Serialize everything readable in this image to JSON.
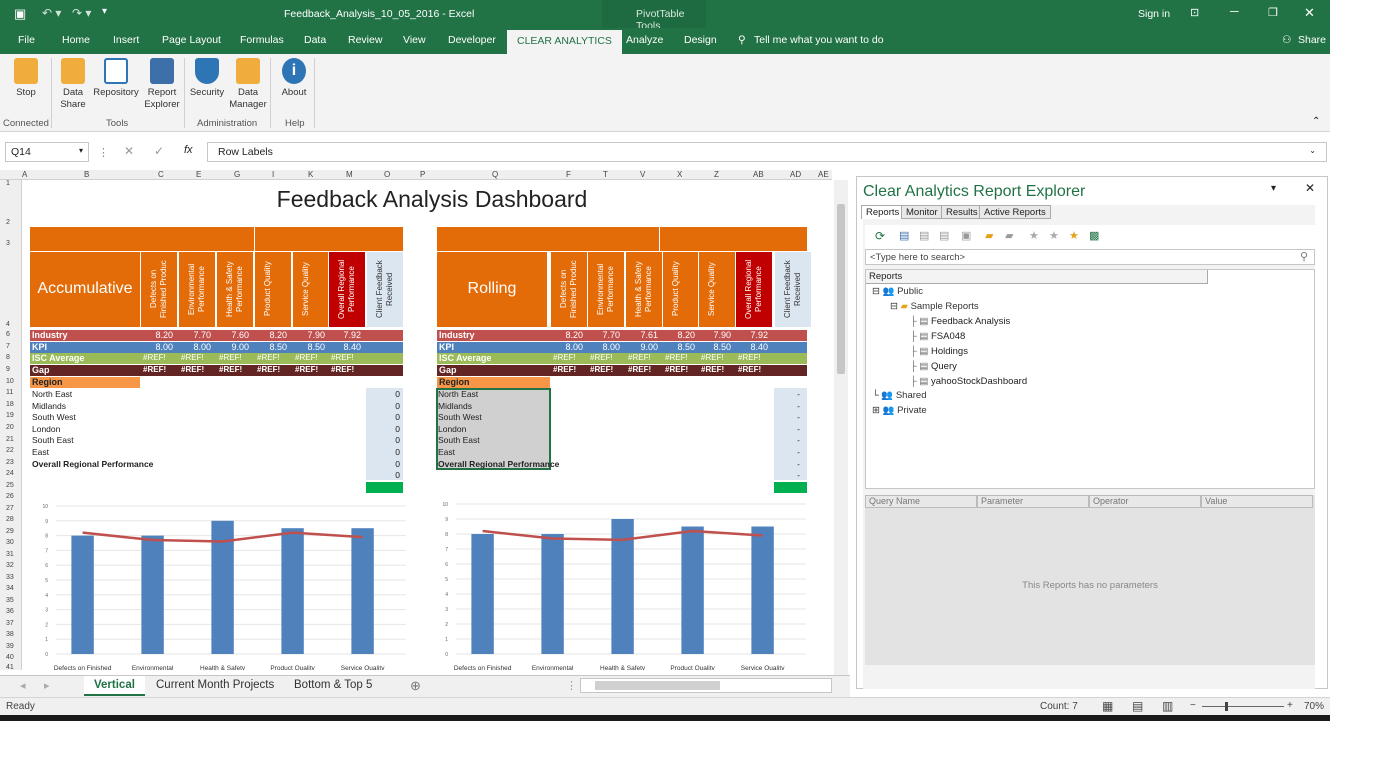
{
  "window": {
    "title": "Feedback_Analysis_10_05_2016 - Excel",
    "context": "PivotTable Tools",
    "signin": "Sign in"
  },
  "ribbon_tabs": [
    "File",
    "Home",
    "Insert",
    "Page Layout",
    "Formulas",
    "Data",
    "Review",
    "View",
    "Developer",
    "CLEAR ANALYTICS",
    "Analyze",
    "Design"
  ],
  "tell_me": "Tell me what you want to do",
  "share": "Share",
  "ribbon": {
    "buttons": [
      {
        "label": "Stop",
        "icon": "database-stop-icon"
      },
      {
        "label": "Data Share",
        "icon": "data-share-icon"
      },
      {
        "label": "Repository",
        "icon": "repository-icon"
      },
      {
        "label": "Report Explorer",
        "icon": "report-explorer-icon"
      },
      {
        "label": "Security",
        "icon": "shield-icon"
      },
      {
        "label": "Data Manager",
        "icon": "data-manager-icon"
      },
      {
        "label": "About",
        "icon": "info-icon"
      }
    ],
    "groups": [
      "Connected",
      "Tools",
      "Administration",
      "Help"
    ]
  },
  "formula_bar": {
    "name_box": "Q14",
    "formula": "Row Labels",
    "fx": "fx"
  },
  "columns": [
    "A",
    "B",
    "C",
    "E",
    "G",
    "I",
    "K",
    "M",
    "O",
    "P",
    "Q",
    "F",
    "T",
    "V",
    "X",
    "Z",
    "AB",
    "AD",
    "AE"
  ],
  "rows": [
    "1",
    "2",
    "3",
    "4",
    "6",
    "7",
    "8",
    "9",
    "10",
    "11",
    "18",
    "19",
    "20",
    "21",
    "22",
    "23",
    "24",
    "25",
    "26",
    "27",
    "28",
    "29",
    "30",
    "31",
    "32",
    "33",
    "34",
    "35",
    "36",
    "37",
    "38",
    "39",
    "40",
    "41"
  ],
  "dashboard": {
    "title": "Feedback Analysis Dashboard",
    "left": {
      "heading": "Accumulative",
      "industry": [
        "8.20",
        "7.70",
        "7.60",
        "8.20",
        "7.90",
        "7.92"
      ],
      "kpi": [
        "8.00",
        "8.00",
        "9.00",
        "8.50",
        "8.50",
        "8.40"
      ]
    },
    "right": {
      "heading": "Rolling",
      "industry": [
        "8.20",
        "7.70",
        "7.61",
        "8.20",
        "7.90",
        "7.92"
      ],
      "kpi": [
        "8.00",
        "8.00",
        "9.00",
        "8.50",
        "8.50",
        "8.40"
      ]
    },
    "col_headers": [
      "Defects on Finished Produc",
      "Environmental Performance",
      "Health & Safety Performance",
      "Product Quality",
      "Service Quality",
      "Overall Regional Performance",
      "Client Feedback Received"
    ],
    "row_labels": {
      "industry": "Industry",
      "kpi": "KPI",
      "isc": "ISC Average",
      "gap": "Gap",
      "region": "Region"
    },
    "ref_error": "#REF!",
    "regions": [
      "North East",
      "Midlands",
      "South West",
      "London",
      "South East",
      "East"
    ],
    "overall": "Overall Regional Performance",
    "client_left": [
      "0",
      "0",
      "0",
      "0",
      "0",
      "0",
      "0",
      "0"
    ],
    "client_right": [
      "-",
      "-",
      "-",
      "-",
      "-",
      "-",
      "-",
      "-"
    ],
    "green_dash": "-"
  },
  "chart_data": [
    {
      "type": "bar",
      "categories": [
        "Defects on Finished",
        "Environmental",
        "Health & Safety",
        "Product Quality",
        "Service Quality"
      ],
      "series": [
        {
          "values": [
            8.0,
            8.0,
            9.0,
            8.5,
            8.5
          ]
        },
        {
          "type": "line",
          "values": [
            8.2,
            7.7,
            7.6,
            8.2,
            7.9
          ]
        }
      ],
      "ylim": [
        0,
        10
      ],
      "yticks": [
        "0",
        "1",
        "2",
        "3",
        "4",
        "5",
        "6",
        "7",
        "8",
        "9",
        "10"
      ]
    },
    {
      "type": "bar",
      "categories": [
        "Defects on Finished",
        "Environmental",
        "Health & Safety",
        "Product Quality",
        "Service Quality"
      ],
      "series": [
        {
          "values": [
            8.0,
            8.0,
            9.0,
            8.5,
            8.5
          ]
        },
        {
          "type": "line",
          "values": [
            8.2,
            7.7,
            7.61,
            8.2,
            7.9
          ]
        }
      ],
      "ylim": [
        0,
        10
      ],
      "yticks": [
        "0",
        "1",
        "2",
        "3",
        "4",
        "5",
        "6",
        "7",
        "8",
        "9",
        "10"
      ]
    }
  ],
  "sheet_tabs": [
    "Vertical",
    "Current Month Projects",
    "Bottom & Top 5"
  ],
  "status": {
    "ready": "Ready",
    "count": "Count: 7",
    "zoom": "70%"
  },
  "panel": {
    "title": "Clear Analytics Report Explorer",
    "tabs": [
      "Reports",
      "Monitor",
      "Results",
      "Active Reports"
    ],
    "search_placeholder": "<Type here to search>",
    "tree_header": "Reports",
    "tree": {
      "public": "Public",
      "sample": "Sample Reports",
      "reports": [
        "Feedback Analysis",
        "FSA048",
        "Holdings",
        "Query",
        "yahooStockDashboard"
      ],
      "shared": "Shared",
      "private": "Private"
    },
    "param_cols": [
      "Query Name",
      "Parameter",
      "Operator",
      "Value"
    ],
    "no_params": "This Reports has no parameters"
  },
  "colors": {
    "excel_green": "#217346",
    "orange": "#e36c09",
    "red_header": "#c00000",
    "industry": "#c0504d",
    "kpi": "#4f81bd",
    "isc": "#9bbb59",
    "gap": "#632523",
    "region": "#f79646",
    "client": "#dce6f1",
    "bar": "#4f81bd",
    "line": "#c0504d"
  }
}
